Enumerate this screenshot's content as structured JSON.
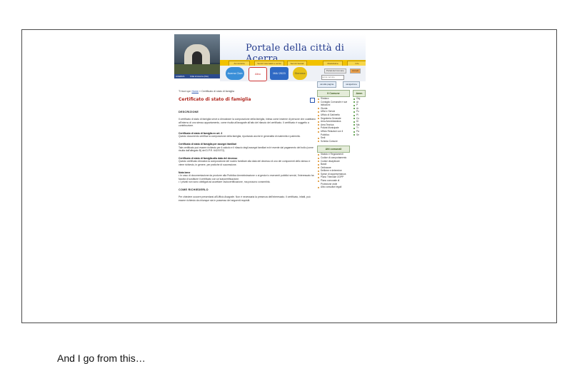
{
  "caption": "And I go from this…",
  "portal": {
    "title": "Portale della città di Acerra",
    "nav_tabs": [
      "Amministra",
      "Servizi telematici e avvisi",
      "Servizi Sociali",
      "Modulistica",
      "Info"
    ],
    "banners": [
      "Acerra Club",
      "Albo",
      "IMU 2023",
      "Stemma"
    ],
    "blue_bar_left": "ACERRA",
    "blue_bar_right": "Città di Acerra (NA)",
    "util_links": [
      "Portal del Comune",
      "Accedi"
    ],
    "search_placeholder": "cerca nel sito",
    "goto_label": "vai alla pagina",
    "goto_button": "navigazione"
  },
  "breadcrumb": {
    "prefix": "Ti trovi qui:",
    "home": "Home",
    "sep": "»",
    "current": "Certificato di stato di famiglia"
  },
  "page_title": "Certificato di stato di famiglia",
  "sections": {
    "descrizione_head": "DESCRIZIONE",
    "descrizione_body": "Il certificato di stato di famiglia serve a dimostrare la composizione della famiglia, intesa come insieme di persone che coabitano all'interno di uno stesso appartamento, come risulta all'anagrafe all'atto del rilascio del certificato. Il certificato è soggetto a contribuzione.",
    "art3_head": "Certificato di stato di famiglia ex art. 3",
    "art3_body": "Questo documento certifica la composizione della famiglia, riportando anche le generalità di maternità e paternità.",
    "assegni_head": "Certificato di stato di famiglia per assegni familiari",
    "assegni_body": "Tale certificato può essere richiesto per il calcolo e il rilascio degli assegni familiari ed è esente dal pagamento del bollo (come risulta dall'allegato B) del D.P.R. 642/1972).",
    "decesso_head": "Certificato di stato di famiglia alla data del decesso",
    "decesso_body": "Questo certificato dimostra la composizione del nucleo familiare alla data del decesso di uno dei componenti dello stesso e viene richiesto, in genere, per pratiche di successione.",
    "nota_head": "Nota bene",
    "nota_body1": "• In caso di documentazione da produrre alla Pubblica Amministrazione o ai gestori o esercenti pubblici servizi, l'interessato ha facoltà di sostituire il certificato con un'autocertificazione.",
    "nota_body2": "• I privati non sono obbligati ad accettare l'autocertificazione, ma possono consentirla.",
    "come_head": "COME RICHIEDERLO",
    "come_body": "Per chiedere occorre presentarsi all'Ufficio Anagrafe. Non è necessaria la presenza dell'interessato. Il certificato, infatti, può essere richiesto da chiunque sia in possesso dei seguenti requisiti:"
  },
  "sidebar": {
    "comune_head": "Il Comune",
    "comune_items": [
      "Sindaco",
      "Consiglio Comunale e sue Istituzioni",
      "Giunta",
      "Uffici e Servizi",
      "Ufficio di Gabinetto",
      "Segreteria Generale",
      "Area Amministrativa",
      "Area Tecnica",
      "Polizia Municipale",
      "Ufficio Relazioni con il Pubblico",
      "Sedi",
      "Scheda Comune"
    ],
    "atti_head": "Atti comunali",
    "atti_items": [
      "Statuto e Regolamenti",
      "Codice di comportamento",
      "Codice disciplinare",
      "Bandi",
      "Ordinanze",
      "Delibere e determine",
      "Spese di rappresentanza",
      "Piano Triennale OOPP",
      "Piano comunale di Protezione civile",
      "Albo consultori legali"
    ],
    "col2_head": "Amm",
    "col2_items": [
      "Org",
      "Ar",
      "P",
      "Ar",
      "Po",
      "Pi",
      "Co",
      "Di",
      "Ma",
      "Tr",
      "Pa",
      "Se"
    ]
  }
}
